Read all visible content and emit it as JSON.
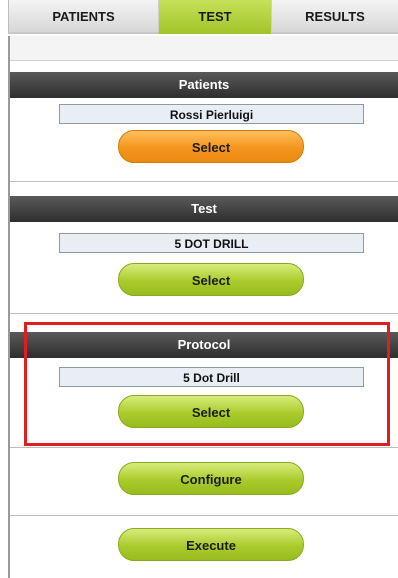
{
  "tabs": {
    "patients": "PATIENTS",
    "test": "TEST",
    "results": "RESULTS"
  },
  "patients_section": {
    "title": "Patients",
    "value": "Rossi Pierluigi",
    "button": "Select"
  },
  "test_section": {
    "title": "Test",
    "value": "5 DOT DRILL",
    "button": "Select"
  },
  "protocol_section": {
    "title": "Protocol",
    "value": "5 Dot Drill",
    "button": "Select"
  },
  "actions": {
    "configure": "Configure",
    "execute": "Execute"
  },
  "colors": {
    "accent_green": "#a9cc2c",
    "accent_orange": "#f4951c",
    "header_dark": "#2e2e2e",
    "highlight_red": "#e01e1e"
  }
}
